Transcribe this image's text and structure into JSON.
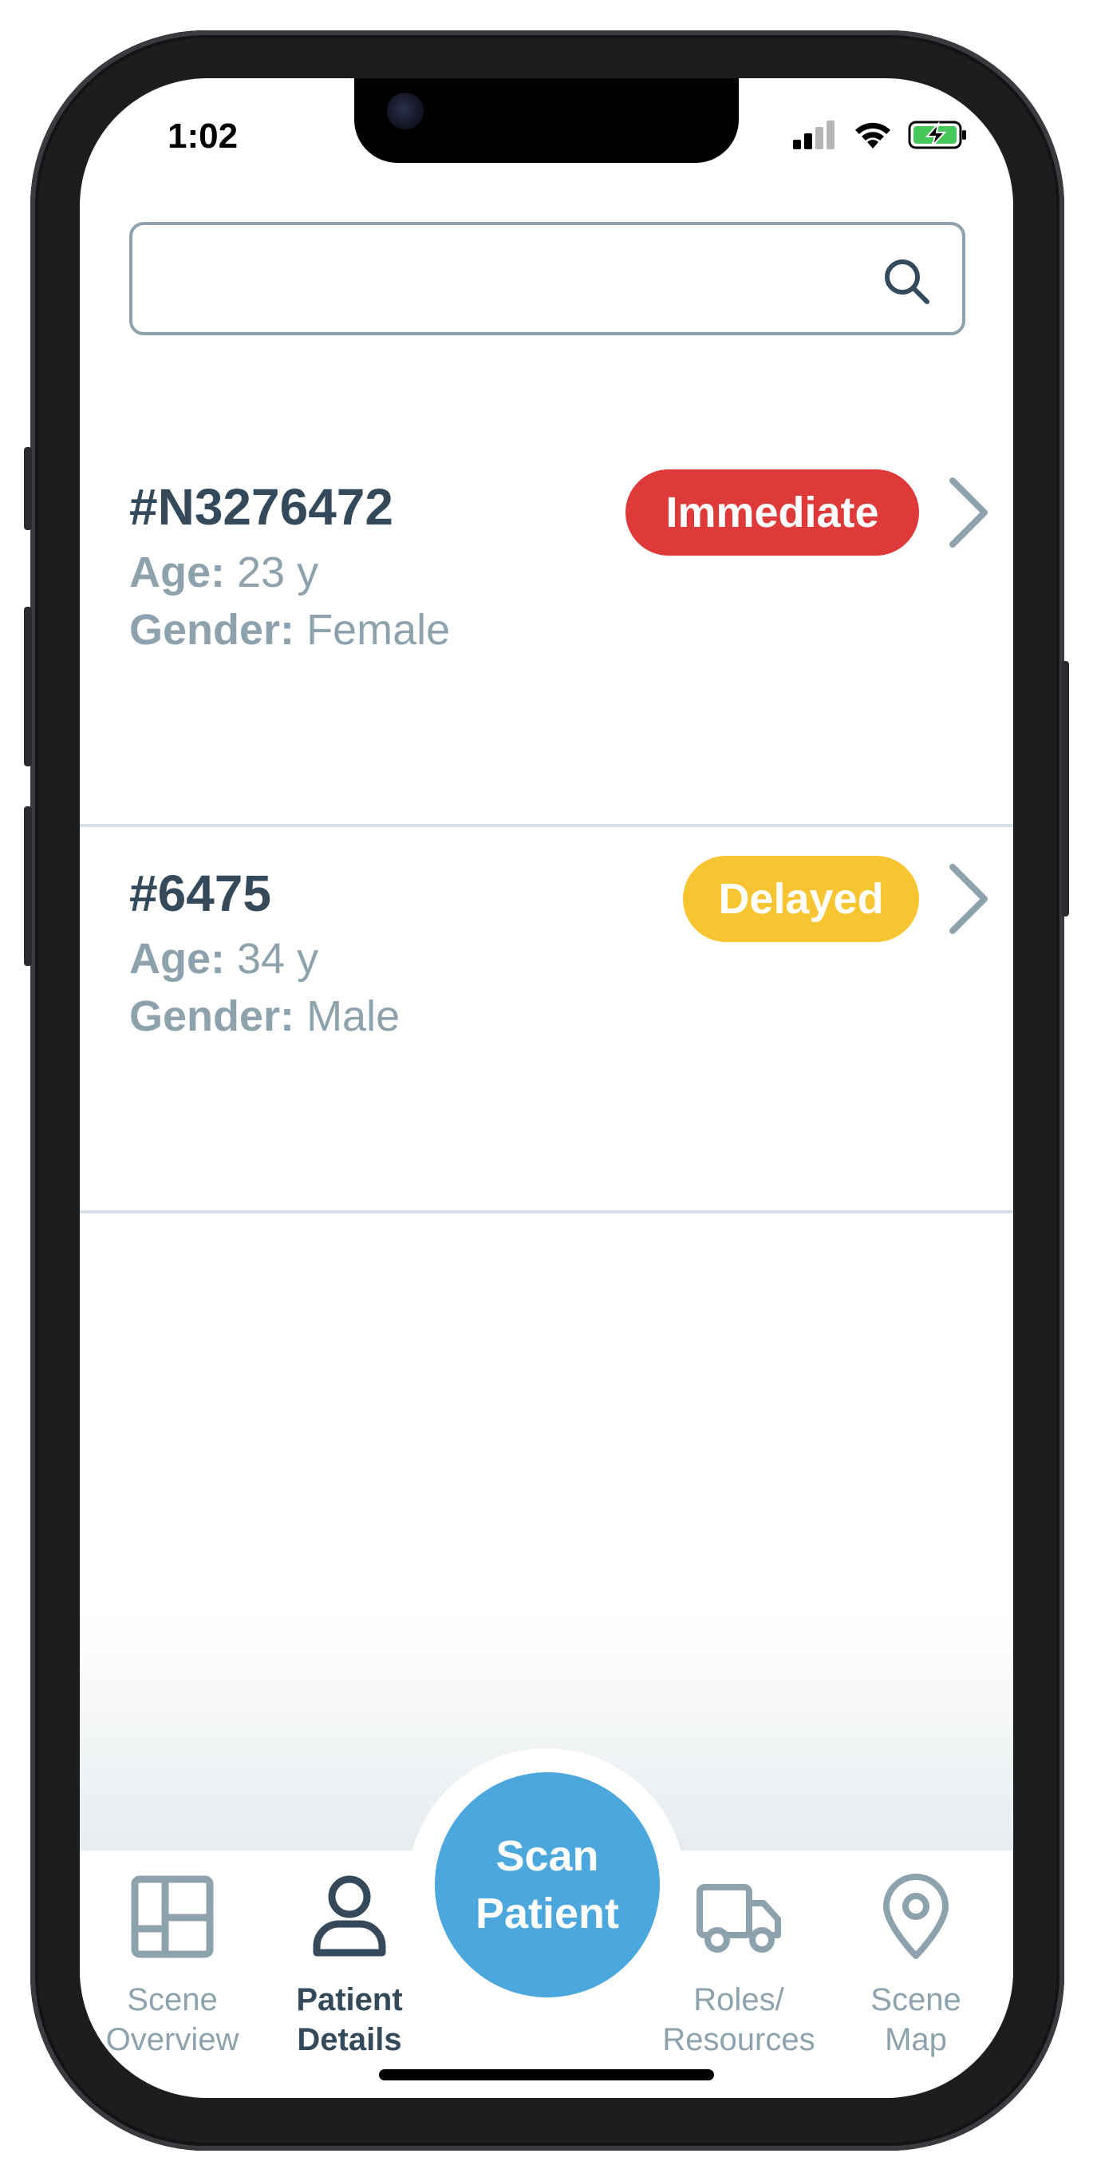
{
  "status_bar": {
    "time": "1:02"
  },
  "search": {
    "value": "",
    "placeholder": ""
  },
  "patients": [
    {
      "id": "#N3276472",
      "age_label": "Age:",
      "age_value": "23 y",
      "gender_label": "Gender:",
      "gender_value": "Female",
      "triage": "Immediate",
      "triage_color": "#df3a3a"
    },
    {
      "id": "#6475",
      "age_label": "Age:",
      "age_value": "34 y",
      "gender_label": "Gender:",
      "gender_value": "Male",
      "triage": "Delayed",
      "triage_color": "#f7c531"
    }
  ],
  "tabs": [
    {
      "label": "Scene\nOverview",
      "icon": "layout-icon",
      "active": false
    },
    {
      "label": "Patient\nDetails",
      "icon": "person-icon",
      "active": true
    },
    {
      "label": "Roles/\nResources",
      "icon": "truck-icon",
      "active": false
    },
    {
      "label": "Scene\nMap",
      "icon": "map-pin-icon",
      "active": false
    }
  ],
  "scan_button": {
    "label": "Scan\nPatient",
    "color": "#4ba7dc"
  },
  "colors": {
    "primary_text": "#34495a",
    "secondary_text": "#8ea2ae",
    "divider": "#d7e0e5"
  }
}
